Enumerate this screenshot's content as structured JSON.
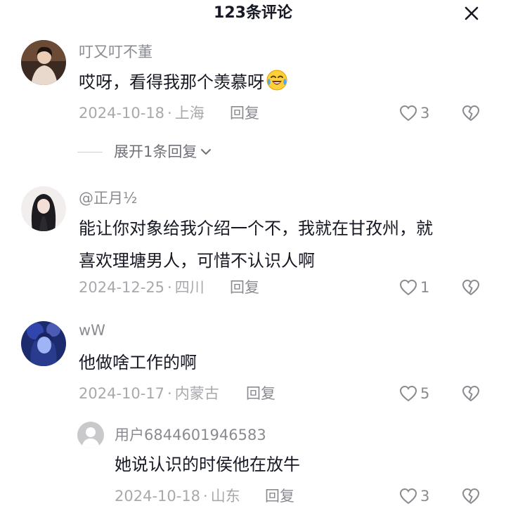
{
  "header": {
    "title": "123条评论",
    "close_icon": "close-icon"
  },
  "comments": [
    {
      "username": "叮又叮不董",
      "text": "哎呀，看得我那个羡慕呀",
      "emoji": "laughing-tears-emoji",
      "date": "2024-10-18",
      "location": "上海",
      "reply_label": "回复",
      "likes": "3",
      "expand_label": "展开1条回复",
      "avatar_colors": [
        "#3b2a22",
        "#e8d9cc"
      ]
    },
    {
      "username": "@正月½",
      "text_line1": "能让你对象给我介绍一个不，我就在甘孜州，就",
      "text_line2": "喜欢理塘男人，可惜不认识人啊",
      "date": "2024-12-25",
      "location": "四川",
      "reply_label": "回复",
      "likes": "1",
      "avatar_colors": [
        "#1d1b1f",
        "#f2eeee"
      ]
    },
    {
      "username": "wW",
      "text": "他做啥工作的啊",
      "date": "2024-10-17",
      "location": "内蒙古",
      "reply_label": "回复",
      "likes": "5",
      "avatar_colors": [
        "#2a3a8c",
        "#9fb4f5"
      ]
    }
  ],
  "reply": {
    "username": "用户6844601946583",
    "text": "她说认识的时侯他在放牛",
    "date": "2024-10-18",
    "location": "山东",
    "reply_label": "回复",
    "likes": "3",
    "avatar_colors": [
      "#c9c9cc",
      "#ffffff"
    ]
  },
  "dot": "·",
  "colors": {
    "text_primary": "#161823",
    "text_secondary": "#8a8b91",
    "text_meta": "#a8a9ad",
    "background": "#ffffff"
  }
}
